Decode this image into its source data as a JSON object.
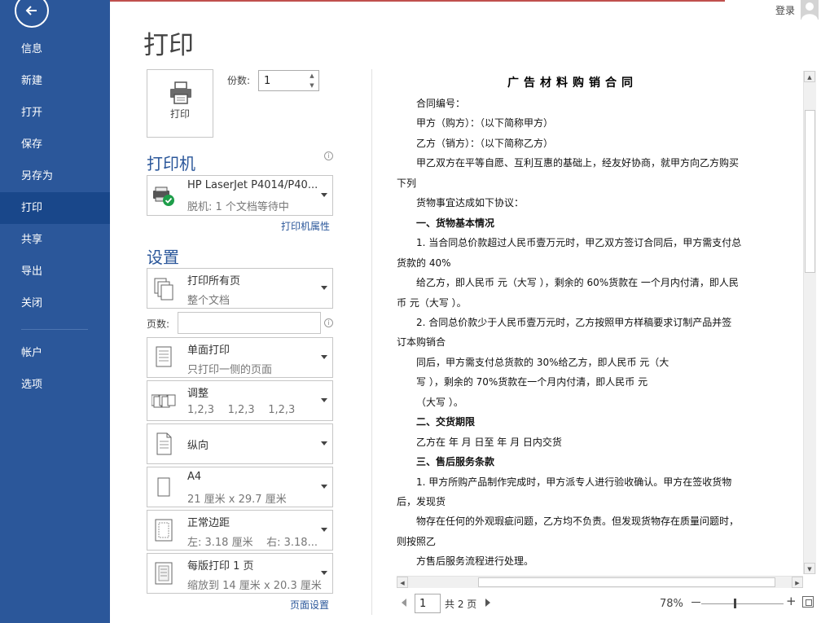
{
  "nav": {
    "items": [
      "信息",
      "新建",
      "打开",
      "保存",
      "另存为",
      "打印",
      "共享",
      "导出",
      "关闭"
    ],
    "items2": [
      "帐户",
      "选项"
    ],
    "active": "打印"
  },
  "header": {
    "login": "登录"
  },
  "page_title": "打印",
  "print": {
    "button_label": "打印",
    "copies_label": "份数:",
    "copies_value": "1"
  },
  "printer": {
    "heading": "打印机",
    "name": "HP LaserJet P4014/P40...",
    "status": "脱机: 1 个文档等待中",
    "properties_link": "打印机属性"
  },
  "settings": {
    "heading": "设置",
    "range": {
      "title": "打印所有页",
      "sub": "整个文档"
    },
    "pages_label": "页数:",
    "pages_value": "",
    "sides": {
      "title": "单面打印",
      "sub": "只打印一侧的页面"
    },
    "collate": {
      "title": "调整",
      "sub": "1,2,3    1,2,3    1,2,3"
    },
    "orientation": {
      "title": "纵向"
    },
    "paper": {
      "title": "A4",
      "sub": "21 厘米 x 29.7 厘米"
    },
    "margins": {
      "title": "正常边距",
      "sub": "左: 3.18 厘米    右: 3.18..."
    },
    "scaling": {
      "title": "每版打印 1 页",
      "sub": "缩放到 14 厘米 x 20.3 厘米"
    },
    "page_setup_link": "页面设置"
  },
  "document": {
    "title": "广告材料购销合同",
    "lines": [
      {
        "text": "合同编号：",
        "indent": true,
        "bold": false
      },
      {
        "text": "甲方（购方）：（以下简称甲方）",
        "indent": true,
        "bold": false
      },
      {
        "text": "乙方（销方）：（以下简称乙方）",
        "indent": true,
        "bold": false
      },
      {
        "text": "甲乙双方在平等自愿、互利互惠的基础上，经友好协商，就甲方向乙方购买",
        "indent": true,
        "bold": false
      },
      {
        "text": "下列",
        "indent": false,
        "bold": false
      },
      {
        "text": "货物事宜达成如下协议：",
        "indent": true,
        "bold": false
      },
      {
        "text": "一、货物基本情况",
        "indent": true,
        "bold": true
      },
      {
        "text": "1. 当合同总价款超过人民币壹万元时，甲乙双方签订合同后，甲方需支付总",
        "indent": true,
        "bold": false
      },
      {
        "text": "货款的 40%",
        "indent": false,
        "bold": false
      },
      {
        "text": "给乙方，即人民币  元（大写 ），剩余的 60%货款在  一个月内付清，即人民",
        "indent": true,
        "bold": false
      },
      {
        "text": "币  元（大写 ）。",
        "indent": false,
        "bold": false
      },
      {
        "text": "2. 合同总价款少于人民币壹万元时，乙方按照甲方样稿要求订制产品并签",
        "indent": true,
        "bold": false
      },
      {
        "text": "订本购销合",
        "indent": false,
        "bold": false
      },
      {
        "text": "同后，甲方需支付总货款的 30%给乙方，即人民币  元（大",
        "indent": true,
        "bold": false
      },
      {
        "text": "写 ），剩余的 70%货款在一个月内付清，即人民币  元",
        "indent": true,
        "bold": false
      },
      {
        "text": "（大写 ）。",
        "indent": true,
        "bold": false
      },
      {
        "text": "二、交货期限",
        "indent": true,
        "bold": true
      },
      {
        "text": "乙方在        年        月        日至        年        月        日内交货",
        "indent": true,
        "bold": false
      },
      {
        "text": "三、售后服务条款",
        "indent": true,
        "bold": true
      },
      {
        "text": "1. 甲方所购产品制作完成时，甲方派专人进行验收确认。甲方在签收货物",
        "indent": true,
        "bold": false
      },
      {
        "text": "后，发现货",
        "indent": false,
        "bold": false
      },
      {
        "text": "物存在任何的外观瑕疵问题，乙方均不负责。但发现货物存在质量问题时，",
        "indent": true,
        "bold": false
      },
      {
        "text": "则按照乙",
        "indent": false,
        "bold": false
      },
      {
        "text": "方售后服务流程进行处理。",
        "indent": true,
        "bold": false
      }
    ]
  },
  "pager": {
    "current": "1",
    "total": "共 2 页"
  },
  "zoom": {
    "value": "78%",
    "minus": "－",
    "plus": "+",
    "level_percent": 78
  }
}
